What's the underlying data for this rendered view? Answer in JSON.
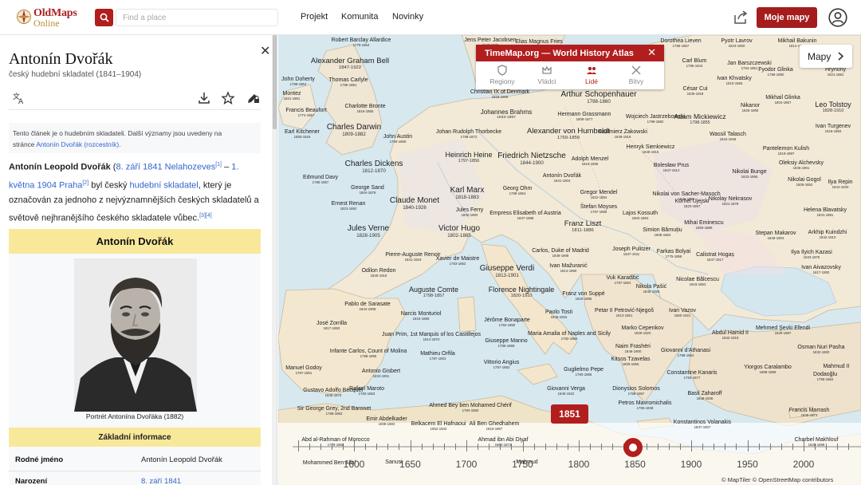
{
  "app": {
    "logo_line1": "OldMaps",
    "logo_line2": "Online"
  },
  "header": {
    "search_placeholder": "Find a place",
    "nav": [
      "Projekt",
      "Komunita",
      "Novinky"
    ],
    "my_maps_label": "Moje mapy"
  },
  "article": {
    "title": "Antonín Dvořák",
    "subtitle": "český hudební skladatel (1841–1904)",
    "hatnote_1": "Tento článek je o hudebním skladateli. Další významy jsou uvedeny na",
    "hatnote_2a": "stránce ",
    "hatnote_link": "Antonín Dvořák (rozcestník)",
    "hatnote_2b": ".",
    "lead_name": "Antonín Leopold Dvořák",
    "lead_birth_open": " (",
    "lead_birth": "8. září 1841 Nelahozeves",
    "lead_ref1": "[1]",
    "lead_dash": " – ",
    "lead_death": "1. května 1904 Praha",
    "lead_ref2": "[2]",
    "lead_t1": " byl český ",
    "lead_link_composer": "hudební skladatel",
    "lead_t2": ", který je označován za jednoho z nejvýznamnějších českých skladatelů a světově nejhranějšího českého skladatele vůbec.",
    "lead_ref3": "[3][4]",
    "infobox_title": "Antonín Dvořák",
    "portrait_caption": "Portrét Antonína Dvořáka (1882)",
    "basic_info_title": "Základní informace",
    "rows": [
      {
        "key": "Rodné jméno",
        "value": "Antonín Leopold Dvořák"
      },
      {
        "key": "Narození",
        "value": "8. září 1841"
      }
    ]
  },
  "timemap": {
    "title": "TimeMap.org — World History Atlas",
    "tabs": [
      {
        "label": "Regiony",
        "icon": "shield-icon",
        "active": false
      },
      {
        "label": "Vládci",
        "icon": "crown-icon",
        "active": false
      },
      {
        "label": "Lidé",
        "icon": "people-icon",
        "active": true
      },
      {
        "label": "Bitvy",
        "icon": "crossed-swords-icon",
        "active": false
      }
    ]
  },
  "map": {
    "layer_button": "Mapy",
    "current_year": "1851",
    "timeline_years": [
      "1600",
      "1650",
      "1700",
      "1750",
      "1800",
      "1850",
      "1900",
      "1950",
      "2000"
    ],
    "attribution": "© MapTiler © OpenStreetMap contributors",
    "people": [
      {
        "name": "Robert Barclay Allardice",
        "dates": "1779-1854",
        "size": 7
      },
      {
        "name": "Jens Peter Jacobsen",
        "dates": "1847-1885",
        "size": 7
      },
      {
        "name": "Elias Magnus Fries",
        "dates": "1794-1878",
        "size": 7
      },
      {
        "name": "Alexander Graham Bell",
        "dates": "1847-1922",
        "size": 9.5
      },
      {
        "name": "John Doherty",
        "dates": "1798-1854",
        "size": 7
      },
      {
        "name": "Thomas Carlyle",
        "dates": "1795-1881",
        "size": 7
      },
      {
        "name": "Montez",
        "dates": "1821-1861",
        "size": 7
      },
      {
        "name": "Francis Beaufort",
        "dates": "1774-1857",
        "size": 7
      },
      {
        "name": "Charlotte Bronte",
        "dates": "1816-1855",
        "size": 7
      },
      {
        "name": "Christian IX of Denmark",
        "dates": "1818-1906",
        "size": 7
      },
      {
        "name": "Arthur Schopenhauer",
        "dates": "1788-1860",
        "size": 10
      },
      {
        "name": "Johannes Brahms",
        "dates": "1833-1897",
        "size": 8
      },
      {
        "name": "Hermann Grassmann",
        "dates": "1809-1877",
        "size": 7
      },
      {
        "name": "Wojciech Jastrzebowski",
        "dates": "1799-1882",
        "size": 7
      },
      {
        "name": "Adam Mickiewicz",
        "dates": "1798-1855",
        "size": 8.5
      },
      {
        "name": "Earl Kitchener",
        "dates": "1850-1916",
        "size": 7
      },
      {
        "name": "Charles Darwin",
        "dates": "1809-1882",
        "size": 10
      },
      {
        "name": "Johan Rudolph Thorbecke",
        "dates": "1798-1872",
        "size": 7
      },
      {
        "name": "Alexander von Humboldt",
        "dates": "1769-1859",
        "size": 9.5
      },
      {
        "name": "Kazimierz Żakowski",
        "dates": "1849-1919",
        "size": 7
      },
      {
        "name": "Wassil Talasch",
        "dates": "1844-1946",
        "size": 7
      },
      {
        "name": "John Austin",
        "dates": "1790-1859",
        "size": 7
      },
      {
        "name": "Heinrich Heine",
        "dates": "1797-1856",
        "size": 9
      },
      {
        "name": "Friedrich Nietzsche",
        "dates": "1844-1900",
        "size": 10
      },
      {
        "name": "Henryk Sienkiewicz",
        "dates": "1846-1916",
        "size": 7
      },
      {
        "name": "Charles Dickens",
        "dates": "1812-1870",
        "size": 10
      },
      {
        "name": "Adolph Menzel",
        "dates": "1815-1905",
        "size": 7
      },
      {
        "name": "Antonín Dvořák",
        "dates": "1841-1904",
        "size": 7
      },
      {
        "name": "Edmund Davy",
        "dates": "1785-1857",
        "size": 7
      },
      {
        "name": "George Sand",
        "dates": "1804-1876",
        "size": 7
      },
      {
        "name": "Karl Marx",
        "dates": "1818-1883",
        "size": 10
      },
      {
        "name": "Georg Ohm",
        "dates": "1789-1854",
        "size": 7
      },
      {
        "name": "Gregor Mendel",
        "dates": "1822-1884",
        "size": 7
      },
      {
        "name": "Nikolai von Sacher-Masoch",
        "dates": "1836-1895",
        "size": 7
      },
      {
        "name": "Claude Monet",
        "dates": "1840-1926",
        "size": 10
      },
      {
        "name": "Ernest Renan",
        "dates": "1823-1892",
        "size": 7
      },
      {
        "name": "Jules Ferry",
        "dates": "1832-1893",
        "size": 7
      },
      {
        "name": "Empress Elisabeth of Austria",
        "dates": "1837-1898",
        "size": 7
      },
      {
        "name": "Štefan Moyses",
        "dates": "1797-1869",
        "size": 7
      },
      {
        "name": "Lajos Kossuth",
        "dates": "1802-1894",
        "size": 7
      },
      {
        "name": "Jules Verne",
        "dates": "1828-1905",
        "size": 10
      },
      {
        "name": "Victor Hugo",
        "dates": "1802-1885",
        "size": 10
      },
      {
        "name": "Franz Liszt",
        "dates": "1811-1886",
        "size": 9.5
      },
      {
        "name": "Simion Bărnuțiu",
        "dates": "1808-1864",
        "size": 7
      },
      {
        "name": "Mihai Eminescu",
        "dates": "1850-1889",
        "size": 7
      },
      {
        "name": "Pierre-Auguste Renoir",
        "dates": "1841-1919",
        "size": 7
      },
      {
        "name": "Xavier de Maistre",
        "dates": "1763-1852",
        "size": 7
      },
      {
        "name": "Carlos, Duke of Madrid",
        "dates": "1848-1909",
        "size": 7
      },
      {
        "name": "Joseph Pulitzer",
        "dates": "1847-1911",
        "size": 7
      },
      {
        "name": "Farkas Bolyai",
        "dates": "1775-1856",
        "size": 7
      },
      {
        "name": "Calistrat Hogaș",
        "dates": "1847-1917",
        "size": 7
      },
      {
        "name": "Odilon Redon",
        "dates": "1840-1916",
        "size": 7
      },
      {
        "name": "Giuseppe Verdi",
        "dates": "1813-1901",
        "size": 10
      },
      {
        "name": "Ivan Mažuranić",
        "dates": "1814-1890",
        "size": 7
      },
      {
        "name": "Vuk Karadžić",
        "dates": "1787-1864",
        "size": 7
      },
      {
        "name": "Nicolae Bălcescu",
        "dates": "1819-1852",
        "size": 7
      },
      {
        "name": "Auguste Comte",
        "dates": "1798-1857",
        "size": 9
      },
      {
        "name": "Florence Nightingale",
        "dates": "1820-1910",
        "size": 9
      },
      {
        "name": "Franz von Suppé",
        "dates": "1819-1895",
        "size": 7
      },
      {
        "name": "Nikola Pašić",
        "dates": "1845-1926",
        "size": 7
      },
      {
        "name": "Pablo de Sarasate",
        "dates": "1844-1908",
        "size": 7
      },
      {
        "name": "Narcis Monturiol",
        "dates": "1819-1885",
        "size": 7
      },
      {
        "name": "Paolo Tosti",
        "dates": "1846-1916",
        "size": 7
      },
      {
        "name": "Petar II Petrović-Njegoš",
        "dates": "1813-1851",
        "size": 7
      },
      {
        "name": "Ivan Vazov",
        "dates": "1850-1921",
        "size": 7
      },
      {
        "name": "José Zorrilla",
        "dates": "1817-1893",
        "size": 7
      },
      {
        "name": "Jérôme Bonaparte",
        "dates": "1784-1860",
        "size": 7
      },
      {
        "name": "Marko Cepenkov",
        "dates": "1829-1920",
        "size": 7
      },
      {
        "name": "Mehmed Şevki Efendi",
        "dates": "1829-1887",
        "size": 7
      },
      {
        "name": "Juan Prim, 1st Marquis of los Castillejos",
        "dates": "1814-1870",
        "size": 7
      },
      {
        "name": "Maria Amalia of Naples and Sicily",
        "dates": "1782-1866",
        "size": 7
      },
      {
        "name": "Abdul Hamid II",
        "dates": "1842-1918",
        "size": 7
      },
      {
        "name": "Infante Carlos, Count of Molina",
        "dates": "1788-1855",
        "size": 7
      },
      {
        "name": "Giuseppe Manno",
        "dates": "1786-1868",
        "size": 7
      },
      {
        "name": "Naim Frashëri",
        "dates": "1846-1900",
        "size": 7
      },
      {
        "name": "Osman Nuri Pasha",
        "dates": "1832-1900",
        "size": 7
      },
      {
        "name": "Mathieu Orfila",
        "dates": "1787-1853",
        "size": 7
      },
      {
        "name": "Kitsos Tzavelas",
        "dates": "1800-1855",
        "size": 7
      },
      {
        "name": "Giovanni d'Athanasi",
        "dates": "1798-1854",
        "size": 7
      },
      {
        "name": "Vittorio Angius",
        "dates": "1797-1862",
        "size": 7
      },
      {
        "name": "Manuel Godoy",
        "dates": "1767-1851",
        "size": 7
      },
      {
        "name": "Antonio Gisbert",
        "dates": "1834-1901",
        "size": 7
      },
      {
        "name": "Guglielmo Pepe",
        "dates": "1783-1855",
        "size": 7
      },
      {
        "name": "Constantine Kanaris",
        "dates": "1793-1877",
        "size": 7
      },
      {
        "name": "Yiorgos Caralambo",
        "dates": "1868-1889",
        "size": 7
      },
      {
        "name": "Dodaoğlu",
        "dates": "1796-1864",
        "size": 7
      },
      {
        "name": "Gustavo Adolfo Bécquer",
        "dates": "1836-1870",
        "size": 7
      },
      {
        "name": "Rafael Maroto",
        "dates": "1783-1853",
        "size": 7
      },
      {
        "name": "Giovanni Verga",
        "dates": "1840-1922",
        "size": 7
      },
      {
        "name": "Dionysios Solomos",
        "dates": "1798-1857",
        "size": 7
      },
      {
        "name": "Basil Zaharoff",
        "dates": "1849-1936",
        "size": 7
      },
      {
        "name": "Sir George Grey, 2nd Baronet",
        "dates": "1799-1882",
        "size": 7
      },
      {
        "name": "Ahmed Bey ben Mohamed Chérif",
        "dates": "1784-1850",
        "size": 7
      },
      {
        "name": "Petros Mavromichalis",
        "dates": "1765-1848",
        "size": 7
      },
      {
        "name": "Francis Marrash",
        "dates": "1836-1873",
        "size": 7
      },
      {
        "name": "Emir Abdelkader",
        "dates": "1808-1883",
        "size": 7
      },
      {
        "name": "Belkacem El Hafnaoui",
        "dates": "1852-1942",
        "size": 7
      },
      {
        "name": "Ali Ben Ghedhahem",
        "dates": "1815-1867",
        "size": 7
      },
      {
        "name": "Konstantinos Volanakis",
        "dates": "1837-1907",
        "size": 7
      },
      {
        "name": "Abd al-Rahman of Morocco",
        "dates": "1778-1859",
        "size": 7
      },
      {
        "name": "Ahmad ibn Abi Diyaf",
        "dates": "1804-1874",
        "size": 7
      },
      {
        "name": "Charbel Makhlouf",
        "dates": "1828-1898",
        "size": 7
      },
      {
        "name": "Mohammed Ben Allal",
        "dates": "",
        "size": 7
      },
      {
        "name": "Sanusi",
        "dates": "",
        "size": 7
      },
      {
        "name": "Mahmud",
        "dates": "",
        "size": 7
      },
      {
        "name": "Dorothea Lieven",
        "dates": "1785-1857",
        "size": 7
      },
      {
        "name": "Pyotr Lavrov",
        "dates": "1823-1900",
        "size": 7
      },
      {
        "name": "Mikhail Bakunin",
        "dates": "1814-1876",
        "size": 7
      },
      {
        "name": "Carl Blum",
        "dates": "1786-1844",
        "size": 7
      },
      {
        "name": "Jan Barszczewski",
        "dates": "1794-1851",
        "size": 7
      },
      {
        "name": "Fyodor Glinka",
        "dates": "1786-1880",
        "size": 7
      },
      {
        "name": "Hryhoriy",
        "dates": "1821-1881",
        "size": 7
      },
      {
        "name": "Ivan Khvatsky",
        "dates": "1810-1855",
        "size": 7
      },
      {
        "name": "César Cui",
        "dates": "1835-1918",
        "size": 7
      },
      {
        "name": "Mikhail Glinka",
        "dates": "1804-1857",
        "size": 7
      },
      {
        "name": "Leo Tolstoy",
        "dates": "1828-1910",
        "size": 9
      },
      {
        "name": "Nikanor",
        "dates": "1826-1890",
        "size": 7
      },
      {
        "name": "Ivan Turgenev",
        "dates": "1818-1883",
        "size": 7
      },
      {
        "name": "Pantelemon Kulish",
        "dates": "1819-1897",
        "size": 7
      },
      {
        "name": "Oleksiy Alchevsky",
        "dates": "1835-1901",
        "size": 7
      },
      {
        "name": "Bolesław Prus",
        "dates": "1847-1912",
        "size": 7
      },
      {
        "name": "Nikolai Bunge",
        "dates": "1823-1895",
        "size": 7
      },
      {
        "name": "Nikolai Gogol",
        "dates": "1809-1852",
        "size": 7
      },
      {
        "name": "Ilya Repin",
        "dates": "1844-1930",
        "size": 7
      },
      {
        "name": "Kornel Ujejski",
        "dates": "1823-1897",
        "size": 7
      },
      {
        "name": "Nikolay Nekrasov",
        "dates": "1821-1878",
        "size": 7
      },
      {
        "name": "Helena Blavatsky",
        "dates": "1831-1891",
        "size": 7
      },
      {
        "name": "Stepan Makarov",
        "dates": "1849-1904",
        "size": 7
      },
      {
        "name": "Arkhip Kuindzhi",
        "dates": "1842-1910",
        "size": 7
      },
      {
        "name": "Ilya Ilyich Kazasi",
        "dates": "1833-1876",
        "size": 7
      },
      {
        "name": "Ivan Aivazovsky",
        "dates": "1817-1900",
        "size": 7
      },
      {
        "name": "Mahmud II",
        "dates": "",
        "size": 7
      }
    ]
  }
}
